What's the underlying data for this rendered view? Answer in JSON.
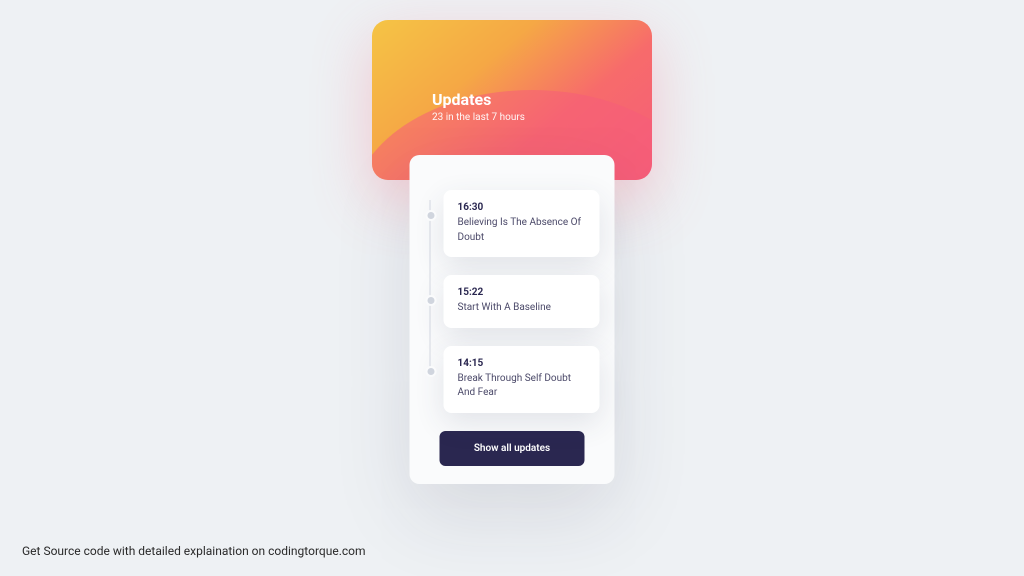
{
  "header": {
    "title": "Updates",
    "subtitle": "23 in the last 7 hours"
  },
  "timeline": [
    {
      "time": "16:30",
      "text": "Believing Is The Absence Of Doubt"
    },
    {
      "time": "15:22",
      "text": "Start With A Baseline"
    },
    {
      "time": "14:15",
      "text": "Break Through Self Doubt And Fear"
    }
  ],
  "button": {
    "label": "Show all updates"
  },
  "footer": {
    "text": "Get Source code with detailed explaination on codingtorque.com"
  }
}
